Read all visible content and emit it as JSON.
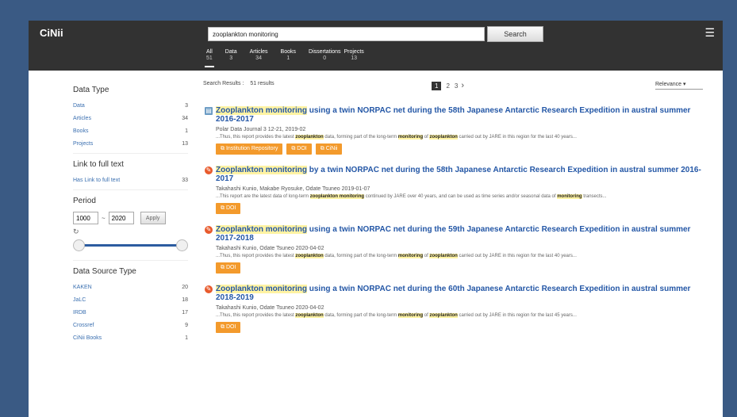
{
  "header": {
    "logo": "CiNii",
    "search_value": "zooplankton monitoring",
    "search_button": "Search",
    "tabs": [
      {
        "label": "All",
        "count": "51"
      },
      {
        "label": "Data",
        "count": "3"
      },
      {
        "label": "Articles",
        "count": "34"
      },
      {
        "label": "Books",
        "count": "1"
      },
      {
        "label": "Dissertations",
        "count": "0"
      },
      {
        "label": "Projects",
        "count": "13"
      }
    ]
  },
  "sidebar": {
    "data_type_title": "Data Type",
    "data_types": [
      {
        "label": "Data",
        "count": "3"
      },
      {
        "label": "Articles",
        "count": "34"
      },
      {
        "label": "Books",
        "count": "1"
      },
      {
        "label": "Projects",
        "count": "13"
      }
    ],
    "link_title": "Link to full text",
    "link_row": {
      "label": "Has Link to full text",
      "count": "33"
    },
    "period_title": "Period",
    "period_from": "1000",
    "period_to": "2020",
    "apply_label": "Apply",
    "tilde": "~",
    "period_slider_from": 0.0,
    "period_slider_to": 1.0,
    "source_title": "Data Source Type",
    "sources": [
      {
        "label": "KAKEN",
        "count": "20"
      },
      {
        "label": "JaLC",
        "count": "18"
      },
      {
        "label": "IRDB",
        "count": "17"
      },
      {
        "label": "Crossref",
        "count": "9"
      },
      {
        "label": "CiNii Books",
        "count": "1"
      }
    ]
  },
  "main": {
    "results_label": "Search Results :",
    "results_count": "51 results",
    "pages": [
      "1",
      "2",
      "3"
    ],
    "sort_label": "Relevance ▾",
    "results": [
      {
        "icon": "database-icon",
        "title_hl": "Zooplankton monitoring",
        "title_rest": " using a twin NORPAC net during the 58th Japanese Antarctic Research Expedition in austral summer 2016-2017",
        "meta": "Polar Data Journal 3 12-21, 2019-02",
        "snip": [
          "...Thus, this report provides the latest ",
          "zooplankton",
          " data, forming part of the long-term ",
          "monitoring",
          " of ",
          "zooplankton",
          " carried out by JARE in this region for the last 40 years..."
        ],
        "buttons": [
          "Institution Repository",
          "DOI",
          "CiNii"
        ]
      },
      {
        "icon": "article-icon",
        "title_hl": "Zooplankton monitoring",
        "title_rest": " by a twin NORPAC net during the 58th Japanese Antarctic Research Expedition in austral summer 2016-2017",
        "meta": "Takahashi Kunio, Makabe Ryosuke, Odate Tsuneo   2019-01-07",
        "snip": [
          "...This report are the latest data of long-term ",
          "zooplankton monitoring",
          " continued by JARE over 40 years, and can be used as time series and/or seasonal data of ",
          "monitoring",
          " transects..."
        ],
        "buttons": [
          "DOI"
        ]
      },
      {
        "icon": "article-icon",
        "title_hl": "Zooplankton monitoring",
        "title_rest": " using a twin NORPAC net during the 59th Japanese Antarctic Research Expedition in austral summer 2017-2018",
        "meta": "Takahashi Kunio, Odate Tsuneo   2020-04-02",
        "snip": [
          "...Thus, this report provides the latest ",
          "zooplankton",
          " data, forming part of the long-term ",
          "monitoring",
          " of ",
          "zooplankton",
          " carried out by JARE in this region for the last 40 years..."
        ],
        "buttons": [
          "DOI"
        ]
      },
      {
        "icon": "article-icon",
        "title_hl": "Zooplankton monitoring",
        "title_rest": " using a twin NORPAC net during the 60th Japanese Antarctic Research Expedition in austral summer 2018-2019",
        "meta": "Takahashi Kunio, Odate Tsuneo   2020-04-02",
        "snip": [
          "...Thus, this report provides the latest ",
          "zooplankton",
          " data, forming part of the long-term ",
          "monitoring",
          " of ",
          "zooplankton",
          " carried out by JARE in this region for the last 45 years..."
        ],
        "buttons": [
          "DOI"
        ]
      }
    ]
  },
  "colors": {
    "topbar": "#323232",
    "link": "#2457a6",
    "button": "#f39a2c",
    "highlight": "#fff3a3"
  }
}
